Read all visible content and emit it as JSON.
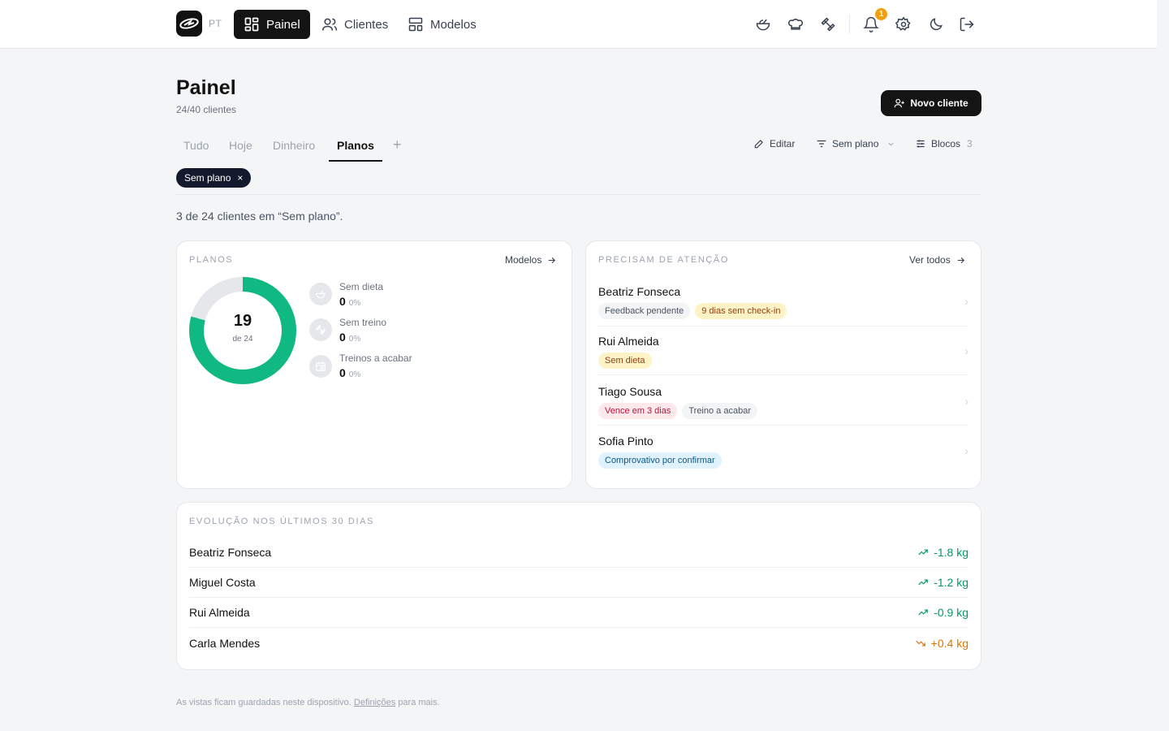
{
  "topbar": {
    "lang": "PT",
    "nav": [
      {
        "label": "Painel",
        "icon": "dashboard-icon",
        "active": true
      },
      {
        "label": "Clientes",
        "icon": "users-icon",
        "active": false
      },
      {
        "label": "Modelos",
        "icon": "templates-icon",
        "active": false
      }
    ],
    "notifications_count": "1"
  },
  "header": {
    "title": "Painel",
    "subtitle": "24/40 clientes",
    "new_client_label": "Novo cliente"
  },
  "tabs": [
    {
      "label": "Tudo",
      "active": false
    },
    {
      "label": "Hoje",
      "active": false
    },
    {
      "label": "Dinheiro",
      "active": false
    },
    {
      "label": "Planos",
      "active": true
    }
  ],
  "tools": {
    "edit_label": "Editar",
    "filter_label": "Sem plano",
    "blocks_label": "Blocos",
    "blocks_count": "3"
  },
  "filter_chip": {
    "label": "Sem plano",
    "close": "×"
  },
  "summary": "3 de 24 clientes em “Sem plano”.",
  "plans_card": {
    "label": "PLANOS",
    "link_label": "Modelos",
    "donut": {
      "value": "19",
      "sub": "de 24",
      "filled": 19,
      "total": 24,
      "color": "#10b981"
    },
    "stats": [
      {
        "label": "Sem dieta",
        "value": "0",
        "pct": "0%",
        "icon": "salad-icon"
      },
      {
        "label": "Sem treino",
        "value": "0",
        "pct": "0%",
        "icon": "dumbbell-icon"
      },
      {
        "label": "Treinos a acabar",
        "value": "0",
        "pct": "0%",
        "icon": "calendar-clock-icon"
      }
    ]
  },
  "attention_card": {
    "label": "PRECISAM DE ATENÇÃO",
    "link_label": "Ver todos",
    "items": [
      {
        "name": "Beatriz Fonseca",
        "tags": [
          {
            "text": "Feedback pendente",
            "tone": "gray"
          },
          {
            "text": "9 dias sem check-in",
            "tone": "yellow"
          }
        ]
      },
      {
        "name": "Rui Almeida",
        "tags": [
          {
            "text": "Sem dieta",
            "tone": "yellow"
          }
        ]
      },
      {
        "name": "Tiago Sousa",
        "tags": [
          {
            "text": "Vence em 3 dias",
            "tone": "red"
          },
          {
            "text": "Treino a acabar",
            "tone": "gray"
          }
        ]
      },
      {
        "name": "Sofia Pinto",
        "tags": [
          {
            "text": "Comprovativo por confirmar",
            "tone": "blue"
          }
        ]
      }
    ]
  },
  "evolution_card": {
    "label": "EVOLUÇÃO NOS ÚLTIMOS 30 DIAS",
    "rows": [
      {
        "name": "Beatriz Fonseca",
        "value": "-1.8 kg",
        "trend": "down"
      },
      {
        "name": "Miguel Costa",
        "value": "-1.2 kg",
        "trend": "down"
      },
      {
        "name": "Rui Almeida",
        "value": "-0.9 kg",
        "trend": "down"
      },
      {
        "name": "Carla Mendes",
        "value": "+0.4 kg",
        "trend": "up"
      }
    ]
  },
  "footer": {
    "before": "As vistas ficam guardadas neste dispositivo.",
    "link": "Definições",
    "after": "para mais."
  },
  "colors": {
    "accent": "#141414",
    "donut": "#10b981",
    "donut_track": "#e5e7eb",
    "positive": "#059669",
    "warning": "#d97706"
  }
}
